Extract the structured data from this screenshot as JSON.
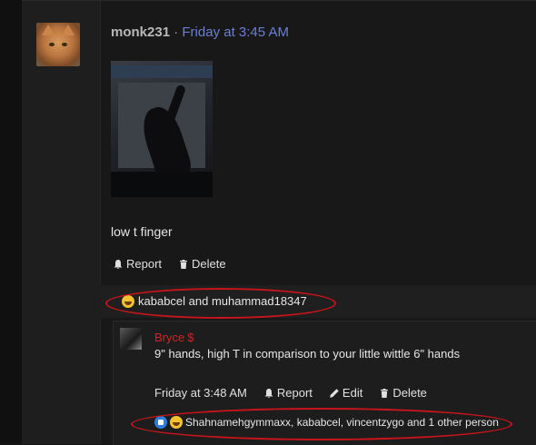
{
  "post": {
    "username": "monk231",
    "separator": "·",
    "timestamp": "Friday at 3:45 AM",
    "body": "low t finger",
    "actions": {
      "report": "Report",
      "delete": "Delete"
    },
    "reactions": {
      "text": "kababcel and muhammad18347",
      "icons": [
        "laughing-emoji"
      ]
    }
  },
  "reply": {
    "username": "Bryce",
    "badge": "$",
    "body": "9\" hands, high T in comparison to your little wittle 6\" hands",
    "timestamp": "Friday at 3:48 AM",
    "actions": {
      "report": "Report",
      "edit": "Edit",
      "delete": "Delete"
    },
    "reactions": {
      "text": "Shahnamehgymmaxx, kababcel, vincentzygo and 1 other person",
      "icons": [
        "like-emoji",
        "laughing-emoji"
      ]
    }
  },
  "colors": {
    "background": "#141414",
    "link": "#6b7fd6",
    "reply_username": "#d02424",
    "annotation": "#c8141b"
  }
}
